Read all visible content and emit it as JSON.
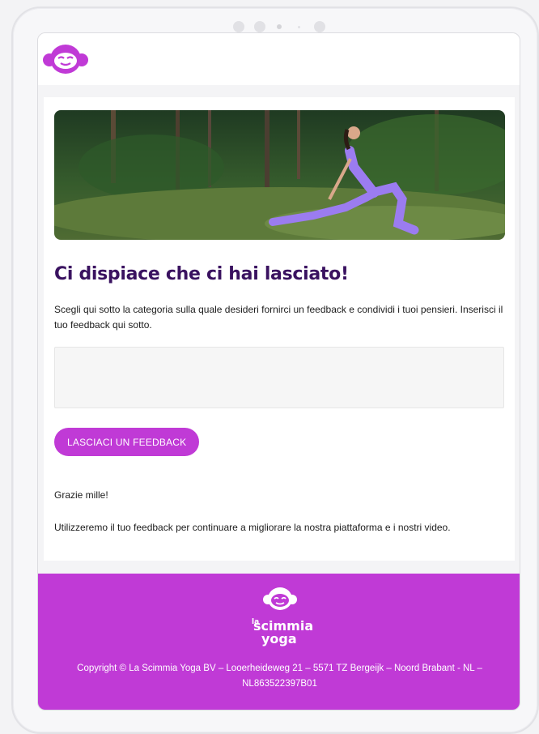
{
  "brand": {
    "name": "La Scimmia Yoga",
    "logo_words": [
      "la",
      "scimmia",
      "yoga"
    ],
    "accent_color": "#c03ad6",
    "heading_color": "#3a1260"
  },
  "hero": {
    "image_icon": "yoga-pose-photo"
  },
  "content": {
    "title": "Ci dispiace che ci hai lasciato!",
    "description": "Scegli qui sotto la categoria sulla quale desideri fornirci un feedback e condividi i tuoi pensieri. Inserisci il tuo feedback qui sotto.",
    "feedback_value": "",
    "button_label": "LASCIACI UN FEEDBACK",
    "thanks": "Grazie mille!",
    "note": "Utilizzeremo il tuo feedback per continuare a migliorare la nostra piattaforma e i nostri video."
  },
  "footer": {
    "copyright": "Copyright © La Scimmia Yoga BV – Looerheideweg 21 – 5571 TZ Bergeijk – Noord Brabant - NL – NL863522397B01"
  }
}
